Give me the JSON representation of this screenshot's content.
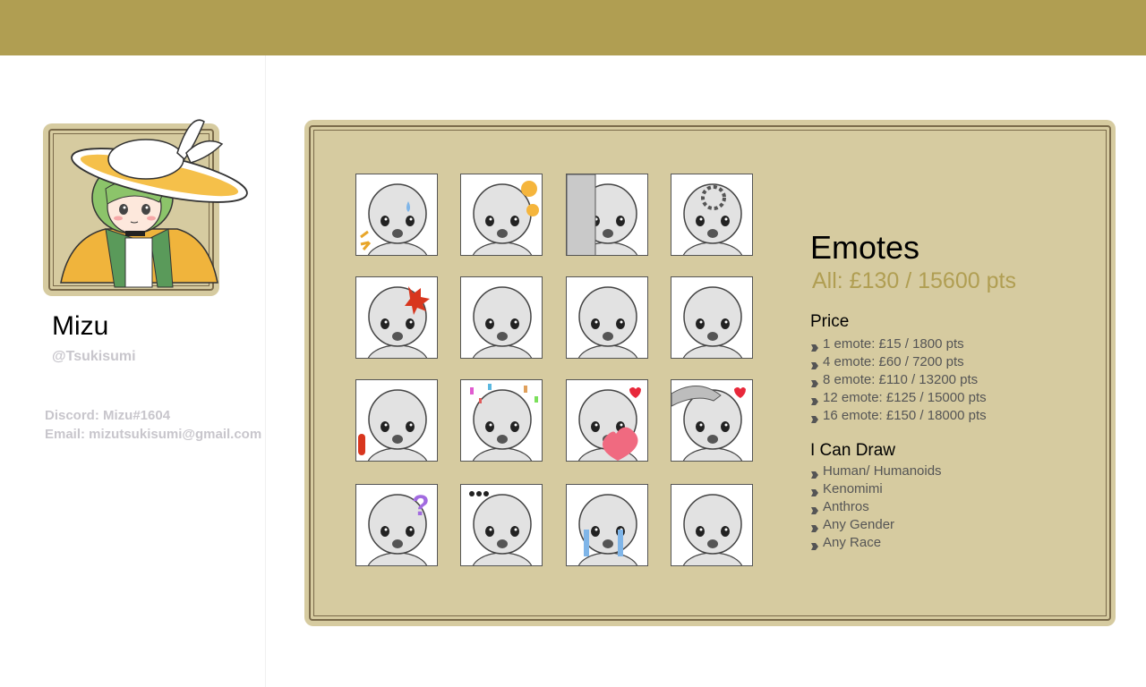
{
  "colors": {
    "accent": "#b09e52",
    "panel": "#d6cba0",
    "border": "#7a6a4a",
    "muted": "#c8c6cc"
  },
  "profile": {
    "name": "Mizu",
    "handle": "@Tsukisumi",
    "discord": "Discord: Mizu#1604",
    "email": "Email: mizutsukisumi@gmail.com"
  },
  "commission": {
    "title": "Emotes",
    "all_price": "All: £130 / 15600 pts",
    "price_heading": "Price",
    "prices": [
      "1 emote: £15 / 1800 pts",
      "4 emote: £60 / 7200 pts",
      "8 emote: £110 / 13200 pts",
      "12 emote: £125 / 15000 pts",
      "16 emote: £150 / 18000 pts"
    ],
    "draw_heading": "I Can Draw",
    "can_draw": [
      "Human/ Humanoids",
      "Kenomimi",
      "Anthros",
      "Any Gender",
      "Any Race"
    ]
  },
  "emotes": [
    "laughing-tears-emote",
    "happy-flowers-emote",
    "peeking-emote",
    "loading-emote",
    "angry-emote",
    "yawning-emote",
    "shy-emote",
    "shocked-emote",
    "surprised-emote",
    "celebrate-emote",
    "heart-emote",
    "headpat-emote",
    "confused-emote",
    "speechless-emote",
    "crying-emote",
    "wink-emote"
  ]
}
